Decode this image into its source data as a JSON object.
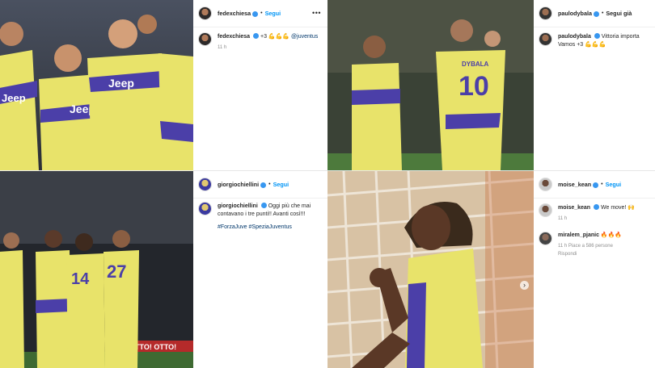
{
  "posts": [
    {
      "username": "fedexchiesa",
      "follow_label": "Segui",
      "comment_user": "fedexchiesa",
      "comment_text": "+3 💪💪💪",
      "mention": "@juventus",
      "time": "11 h"
    },
    {
      "username": "paulodybala",
      "follow_label": "Segui già",
      "comment_user": "paulodybala",
      "comment_text": "Vittoria importa",
      "comment_line2": "Vamos +3 💪💪💪",
      "jersey_text": "DYBALA",
      "jersey_number": "10"
    },
    {
      "username": "giorgiochiellini",
      "follow_label": "Segui",
      "comment_user": "giorgiochiellini",
      "comment_text": "Oggi più che mai contavano i tre punti!! Avanti così!!!",
      "hashtags": "#ForzaJuve #SpeziaJuventus",
      "board_text": "OTTO! OTTO!",
      "jersey_numbers": [
        "14",
        "27"
      ]
    },
    {
      "username": "moise_kean",
      "follow_label": "Segui",
      "comment_user": "moise_kean",
      "comment_text": "We move! 🙌",
      "time": "11 h",
      "reply_user": "miralem_pjanic",
      "reply_text": "🔥🔥🔥",
      "reply_meta_time": "11 h",
      "reply_meta_likes": "Piace a 586 persone",
      "reply_action": "Rispondi"
    }
  ],
  "sponsor_text": "Jeep",
  "icons": [
    "more-options-icon",
    "verified-badge-icon",
    "next-arrow-icon"
  ],
  "colors": {
    "follow_blue": "#0095f6",
    "verified_blue": "#3897f0",
    "jersey_yellow": "#e8e36a",
    "jersey_purple": "#4b3fa8",
    "jersey_white": "#f4f4f4",
    "meta_grey": "#8e8e8e"
  }
}
